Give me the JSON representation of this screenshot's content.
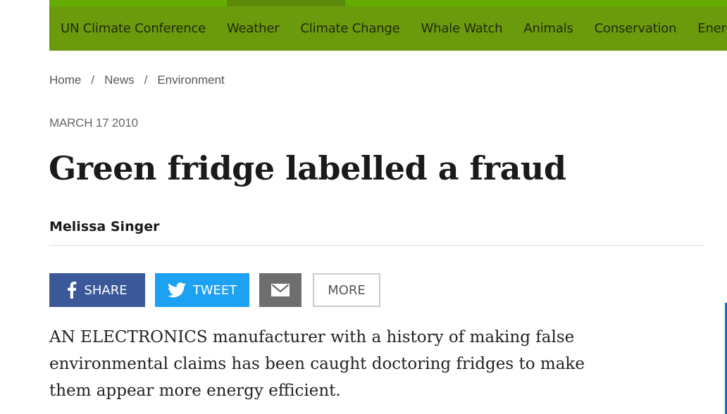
{
  "nav": {
    "items": [
      "UN Climate Conference",
      "Weather",
      "Climate Change",
      "Whale Watch",
      "Animals",
      "Conservation",
      "Energy"
    ]
  },
  "breadcrumb": {
    "items": [
      "Home",
      "News",
      "Environment"
    ],
    "separator": "/"
  },
  "article": {
    "date": "MARCH 17 2010",
    "title": "Green fridge labelled a fraud",
    "author": "Melissa Singer",
    "intro": "AN ELECTRONICS manufacturer with a history of making false environmental claims has been caught doctoring fridges to make them appear more energy efficient."
  },
  "share": {
    "facebook_label": "SHARE",
    "twitter_label": "TWEET",
    "more_label": "MORE",
    "icons": {
      "facebook": "facebook-icon",
      "twitter": "twitter-icon",
      "email": "mail-icon"
    }
  },
  "colors": {
    "nav_bg": "#6c9a0d",
    "facebook": "#3b5998",
    "twitter": "#1da1f2",
    "email": "#6e6e6e"
  }
}
